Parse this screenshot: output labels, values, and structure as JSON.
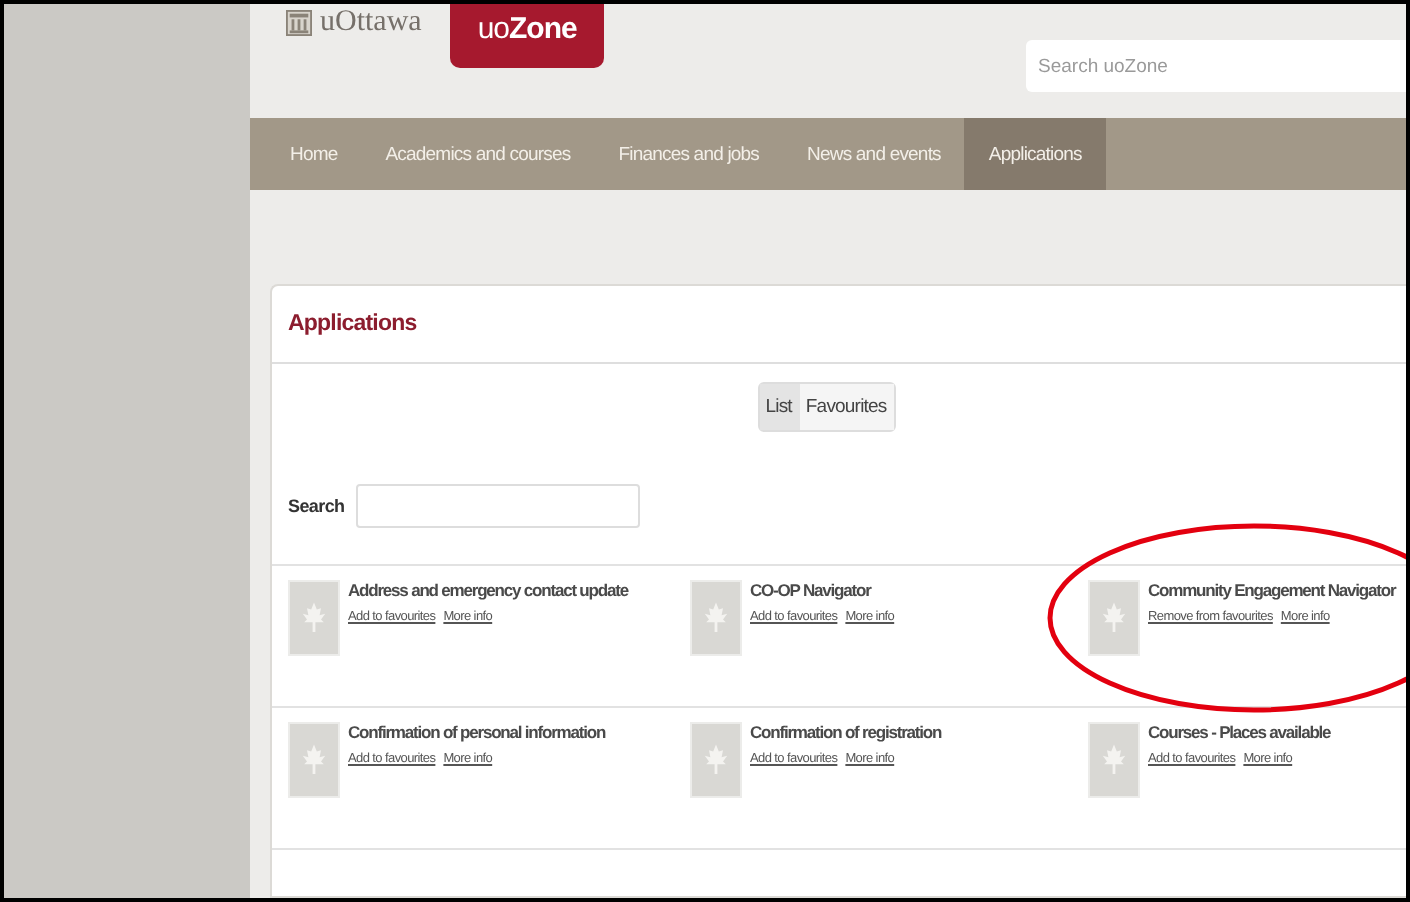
{
  "header": {
    "logo": "uOttawa",
    "app_tab": "uo**Zone**",
    "search": {
      "placeholder": "Search uoZone"
    }
  },
  "nav": [
    {
      "label": "Home",
      "selected": false
    },
    {
      "label": "Academics and courses",
      "selected": false
    },
    {
      "label": "Finances and jobs",
      "selected": false
    },
    {
      "label": "News and events",
      "selected": false
    },
    {
      "label": "Applications",
      "selected": true
    }
  ],
  "panel": {
    "title": "Applications",
    "view_toggle": [
      {
        "label": "List",
        "selected": true
      },
      {
        "label": "Favourites",
        "selected": false
      }
    ],
    "search": {
      "label": "Search"
    },
    "apps": [
      {
        "name": "Address and emergency contact update",
        "links": [
          "Add to favourites",
          "More info"
        ]
      },
      {
        "name": "CO-OP Navigator",
        "links": [
          "Add to favourites",
          "More info"
        ]
      },
      {
        "name": "Community Engagement Navigator",
        "links": [
          "Remove from favourites",
          "More info"
        ],
        "circled": true
      },
      {
        "name": "Confirmation of personal information",
        "links": [
          "Add to favourites",
          "More info"
        ]
      },
      {
        "name": "Confirmation of registration",
        "links": [
          "Add to favourites",
          "More info"
        ]
      },
      {
        "name": "Courses - Places available",
        "links": [
          "Add to favourites",
          "More info"
        ]
      }
    ]
  }
}
